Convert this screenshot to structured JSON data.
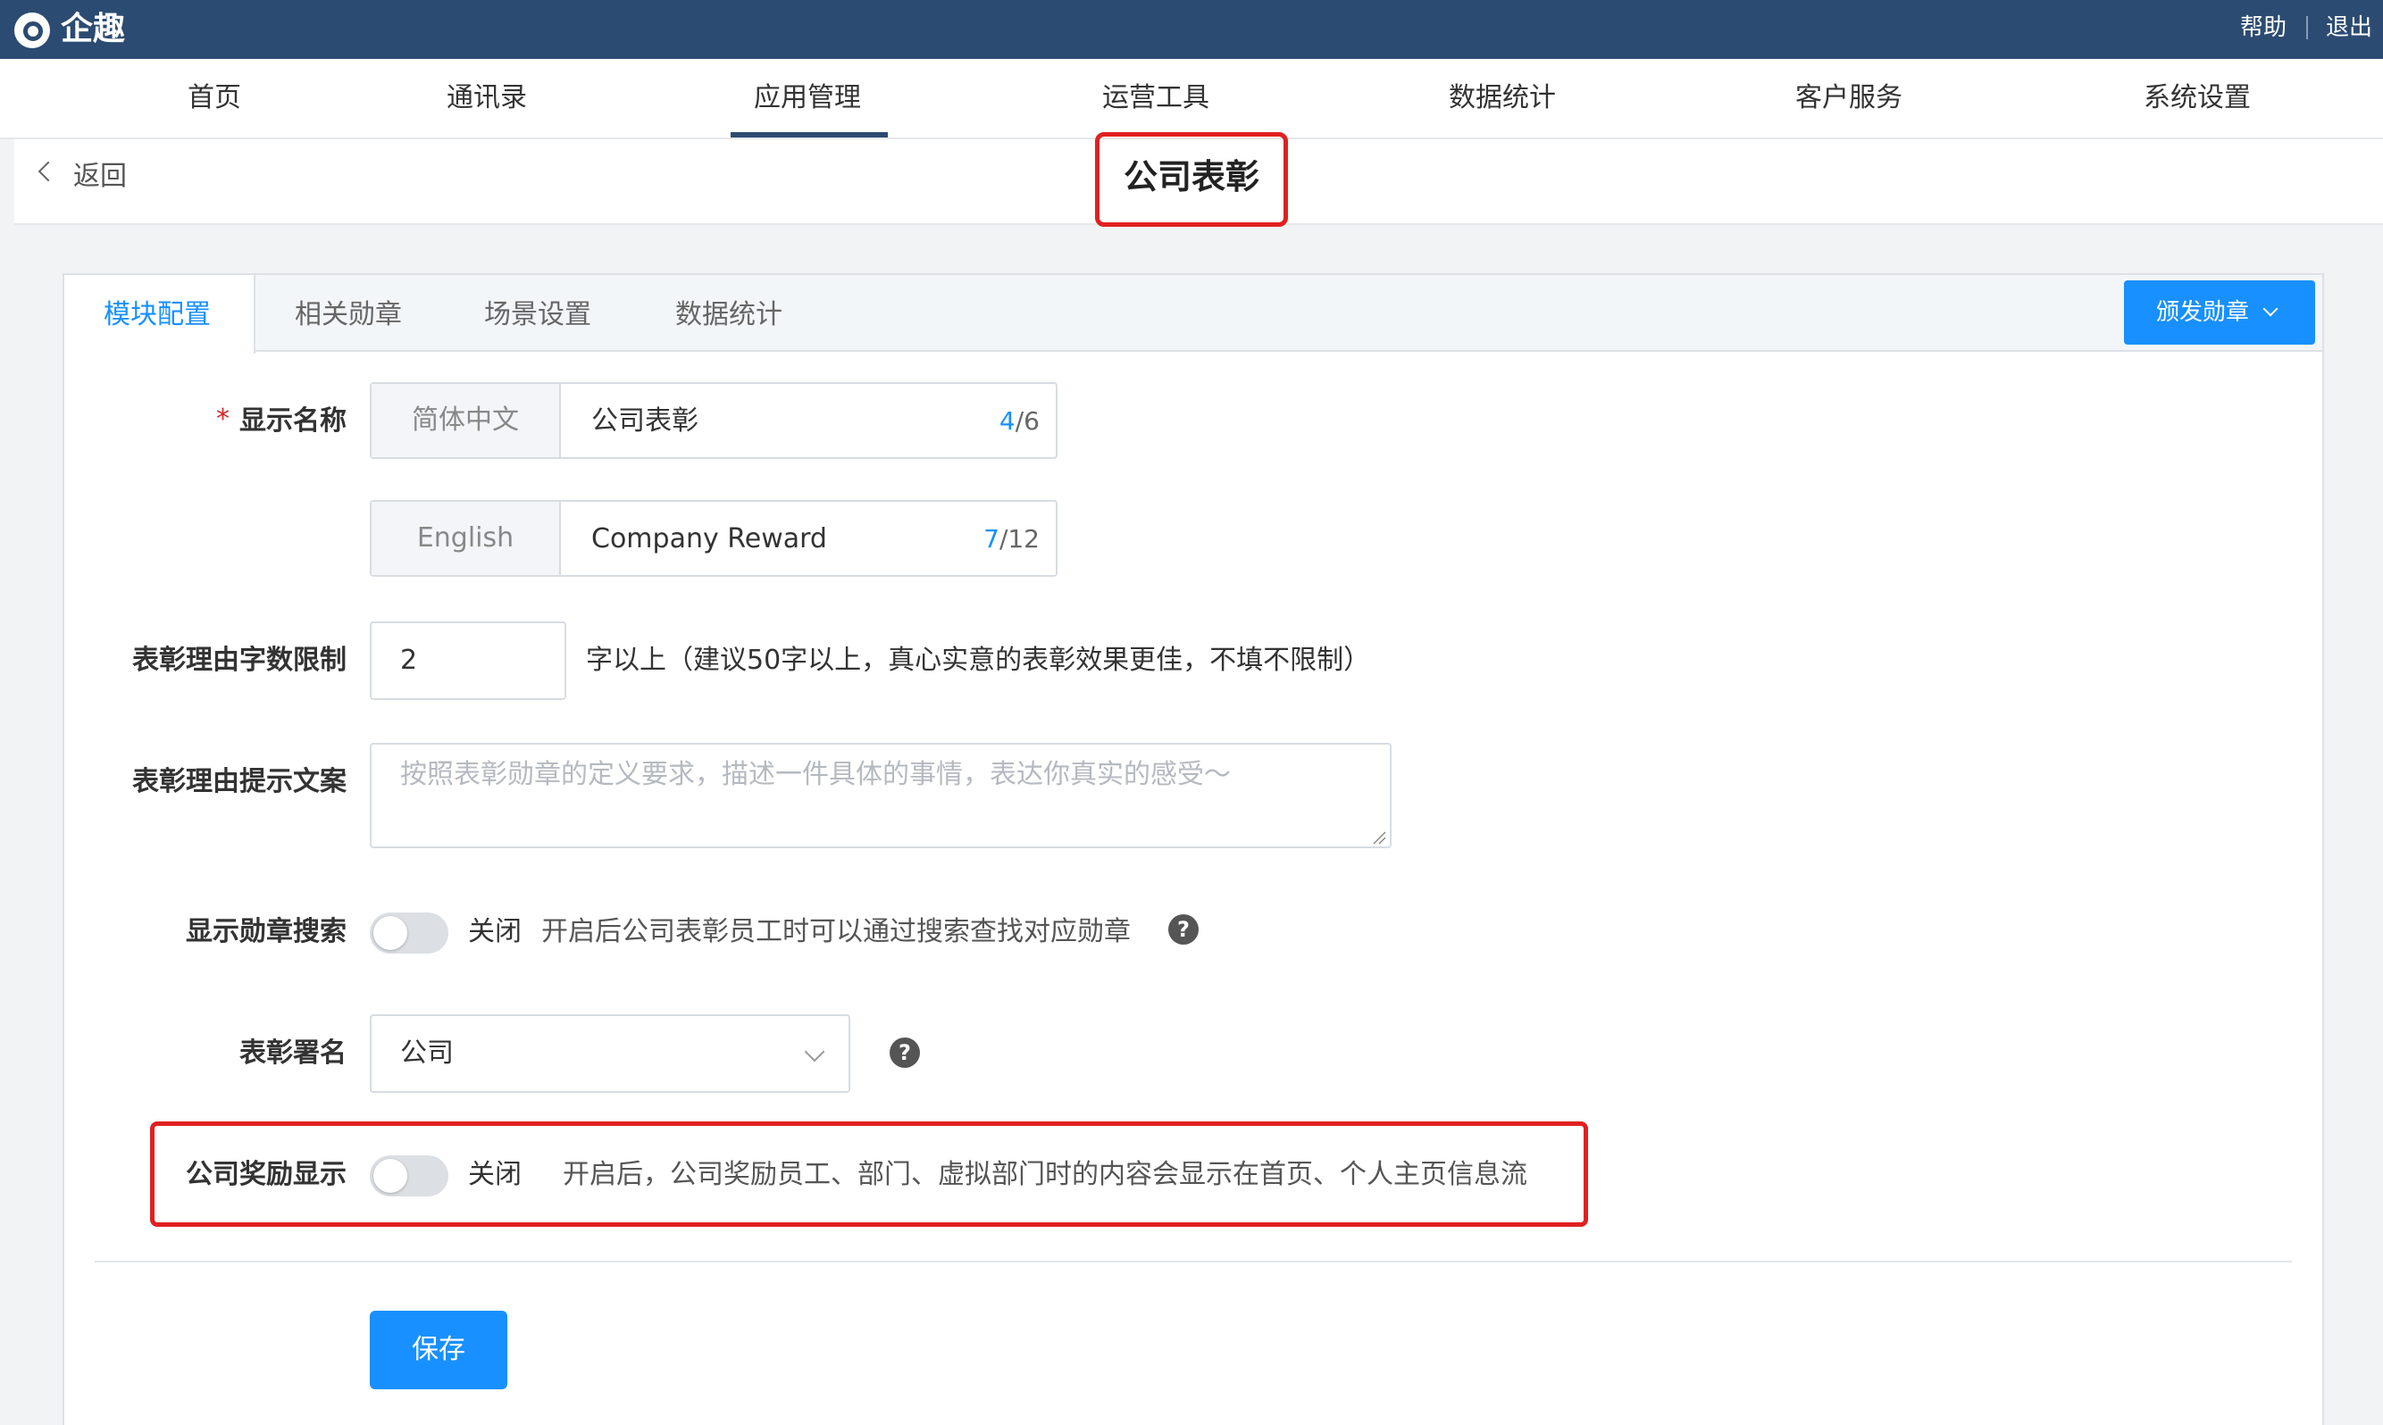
{
  "app": {
    "name": "企趣"
  },
  "topbar": {
    "help": "帮助",
    "logout": "退出"
  },
  "nav": {
    "items": [
      "首页",
      "通讯录",
      "应用管理",
      "运营工具",
      "数据统计",
      "客户服务",
      "系统设置"
    ],
    "active_index": 2
  },
  "header": {
    "back_label": "返回",
    "title": "公司表彰"
  },
  "tabs": {
    "items": [
      "模块配置",
      "相关勋章",
      "场景设置",
      "数据统计"
    ],
    "active_index": 0
  },
  "issue_button": {
    "label": "颁发勋章"
  },
  "form": {
    "display_name": {
      "label": "显示名称",
      "rows": [
        {
          "lang": "简体中文",
          "value": "公司表彰",
          "count": "4",
          "max": "/6"
        },
        {
          "lang": "English",
          "value": "Company Reward",
          "count": "7",
          "max": "/12"
        }
      ]
    },
    "reason_limit": {
      "label": "表彰理由字数限制",
      "value": "2",
      "hint": "字以上（建议50字以上，真心实意的表彰效果更佳，不填不限制）"
    },
    "reason_prompt": {
      "label": "表彰理由提示文案",
      "placeholder": "按照表彰勋章的定义要求，描述一件具体的事情，表达你真实的感受～"
    },
    "badge_search": {
      "label": "显示勋章搜索",
      "state": "关闭",
      "description": "开启后公司表彰员工时可以通过搜索查找对应勋章",
      "enabled": false
    },
    "signature": {
      "label": "表彰署名",
      "value": "公司"
    },
    "reward_display": {
      "label": "公司奖励显示",
      "state": "关闭",
      "description": "开启后，公司奖励员工、部门、虚拟部门时的内容会显示在首页、个人主页信息流",
      "enabled": false
    },
    "save_label": "保存"
  },
  "icons": {
    "back": "chevron-left-icon",
    "dropdown": "chevron-down-icon",
    "help": "question-circle-icon",
    "logo": "qiqu-logo-icon"
  },
  "colors": {
    "topbar": "#2c4b72",
    "primary": "#1890ff",
    "highlight": "#e02020"
  }
}
